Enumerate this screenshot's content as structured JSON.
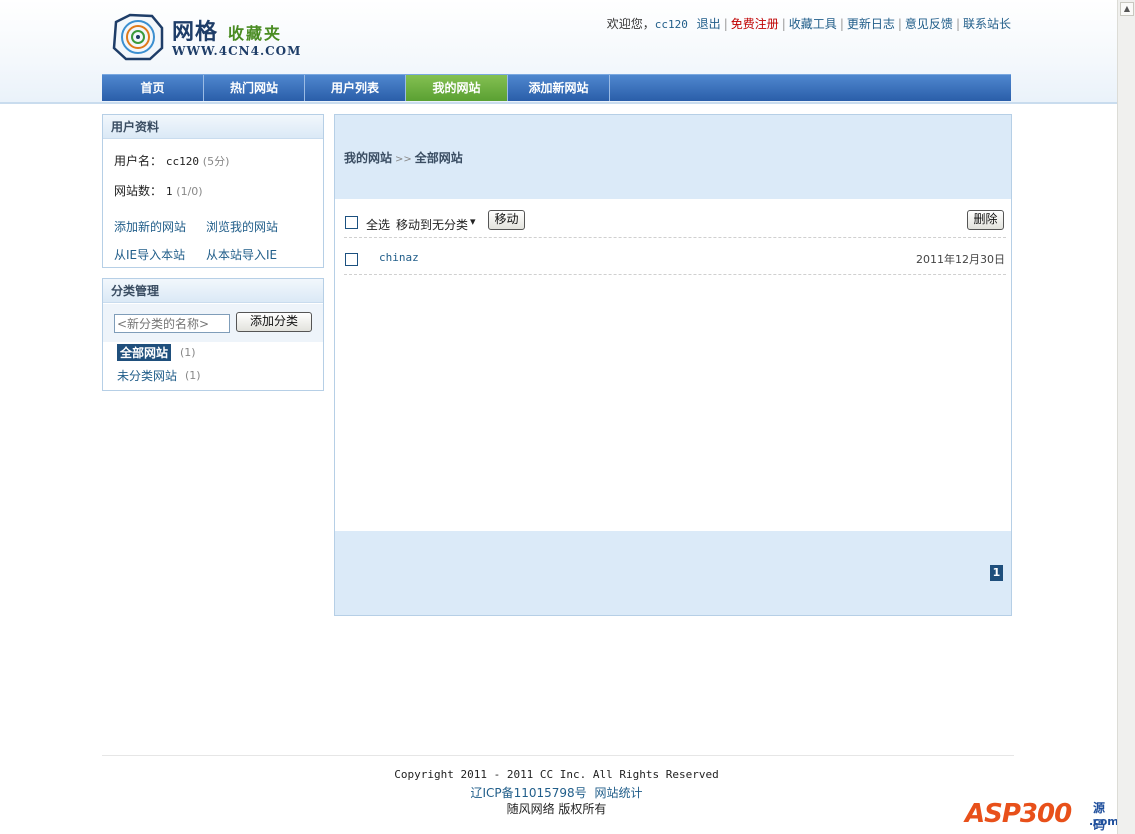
{
  "logo": {
    "name_cn": "网格",
    "name_cn2": "收藏夹",
    "url": "WWW.4CN4.COM"
  },
  "toplinks": {
    "welcome": "欢迎您，",
    "username": "cc120",
    "links": [
      "退出",
      "免费注册",
      "收藏工具",
      "更新日志",
      "意见反馈",
      "联系站长"
    ],
    "highlight_color": "#c00000"
  },
  "nav": {
    "items": [
      "首页",
      "热门网站",
      "用户列表",
      "我的网站",
      "添加新网站"
    ],
    "active": "我的网站"
  },
  "profile": {
    "title": "用户资料",
    "username_label": "用户名：",
    "username": "cc120",
    "points": "(5分)",
    "sites_label": "网站数：",
    "sites_count": "1",
    "sites_ratio": "(1/0)",
    "links": [
      "添加新的网站",
      "浏览我的网站",
      "从IE导入本站",
      "从本站导入IE"
    ]
  },
  "categories": {
    "title": "分类管理",
    "input_placeholder": "<新分类的名称>",
    "add_button": "添加分类",
    "items": [
      {
        "name": "全部网站",
        "count": "(1)",
        "selected": true
      },
      {
        "name": "未分类网站",
        "count": "(1)",
        "selected": false
      }
    ]
  },
  "main": {
    "crumb_root": "我的网站",
    "crumb_sep": ">>",
    "crumb_current": "全部网站",
    "select_all": "全选",
    "move_to": "移动到无分类",
    "move_button": "移动",
    "delete_button": "删除",
    "sites": [
      {
        "name": "chinaz",
        "date": "2011年12月30日"
      }
    ],
    "page": "1"
  },
  "footer": {
    "copyright": "Copyright 2011 - 2011 CC Inc. All Rights Reserved",
    "icp": "辽ICP备11015798号",
    "stats": "网站统计",
    "owner": "随风网络 版权所有"
  },
  "watermark": {
    "brand": "ASP300",
    "suffix": "源码",
    "domain": ".com"
  },
  "colors": {
    "nav_blue": "#2a5ea9",
    "nav_active_green": "#5aa032",
    "link_blue": "#215e8a",
    "panel_bg": "#dbeaf8"
  }
}
